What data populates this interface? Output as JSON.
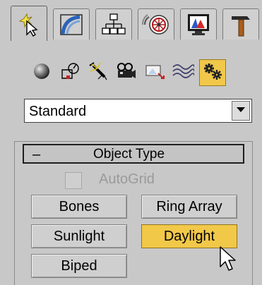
{
  "tabs": [
    {
      "name": "create-tab-icon",
      "active": true
    },
    {
      "name": "modify-tab-icon"
    },
    {
      "name": "hierarchy-tab-icon"
    },
    {
      "name": "motion-tab-icon"
    },
    {
      "name": "display-tab-icon"
    },
    {
      "name": "utilities-tab-icon"
    }
  ],
  "categories": [
    {
      "name": "geometry-icon"
    },
    {
      "name": "shapes-icon"
    },
    {
      "name": "lights-icon"
    },
    {
      "name": "cameras-icon"
    },
    {
      "name": "helpers-icon"
    },
    {
      "name": "space-warps-icon"
    },
    {
      "name": "systems-icon",
      "active": true
    }
  ],
  "dropdown": {
    "value": "Standard"
  },
  "rollout": {
    "toggle": "–",
    "title": "Object Type",
    "autogrid_label": "AutoGrid",
    "buttons": {
      "bones": "Bones",
      "ring_array": "Ring Array",
      "sunlight": "Sunlight",
      "daylight": "Daylight",
      "biped": "Biped"
    }
  },
  "colors": {
    "active": "#f2c849",
    "panel": "#c8c8c8"
  }
}
